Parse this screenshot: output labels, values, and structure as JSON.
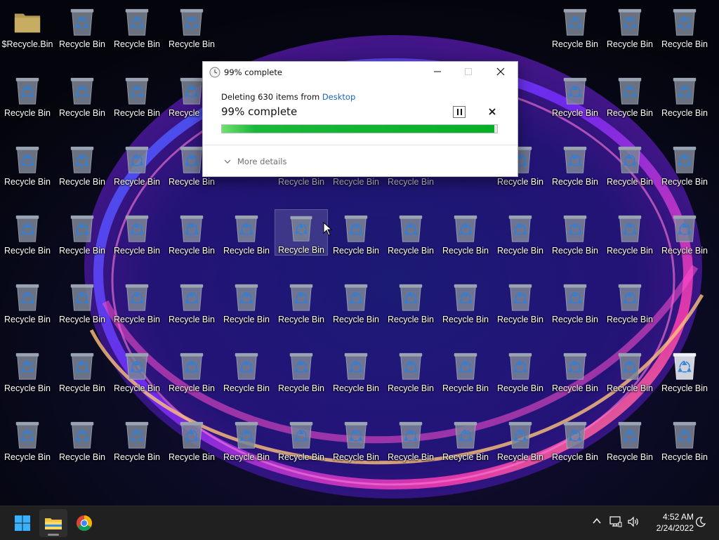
{
  "desktop": {
    "first_icon_label": "$Recycle.Bin",
    "icon_label": "Recycle Bin",
    "columns": 13,
    "rows": 7,
    "missing_cells": [
      [
        2,
        4
      ],
      [
        2,
        8
      ],
      [
        4,
        12
      ]
    ],
    "hidden_by_dialog": [
      [
        0,
        4
      ],
      [
        0,
        5
      ],
      [
        0,
        6
      ],
      [
        0,
        7
      ],
      [
        0,
        8
      ],
      [
        0,
        9
      ],
      [
        1,
        4
      ],
      [
        1,
        5
      ],
      [
        1,
        6
      ],
      [
        1,
        7
      ],
      [
        1,
        8
      ],
      [
        1,
        9
      ]
    ],
    "partially_hidden_cells": [
      [
        1,
        3
      ],
      [
        1,
        9
      ],
      [
        2,
        3
      ],
      [
        2,
        9
      ]
    ],
    "selected_cell": [
      3,
      5
    ],
    "full_bin_cell": [
      5,
      12
    ],
    "icon_name": "recycle-bin-icon"
  },
  "dialog": {
    "title": "99% complete",
    "description_prefix": "Deleting 630 items from ",
    "description_link": "Desktop",
    "progress_text": "99% complete",
    "progress_percent": 99,
    "more_details": "More details",
    "progress_color": "#06b025"
  },
  "taskbar": {
    "time": "4:52 AM",
    "date": "2/24/2022",
    "apps": [
      "windows-start-icon",
      "file-explorer-icon",
      "chrome-icon"
    ],
    "tray": [
      "chevron-up-icon",
      "network-icon",
      "volume-icon",
      "notification-moon-icon"
    ]
  }
}
